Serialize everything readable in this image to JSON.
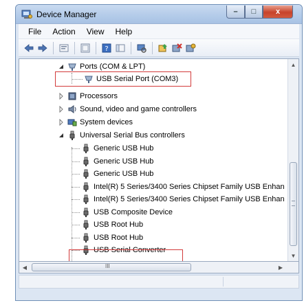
{
  "window": {
    "title": "Device Manager",
    "min_label": "–",
    "max_label": "□",
    "close_label": "x"
  },
  "menu": [
    "File",
    "Action",
    "View",
    "Help"
  ],
  "toolbar": {
    "icons": [
      "back-arrow-icon",
      "forward-arrow-icon",
      "properties-icon",
      "show-hidden-icon",
      "help-icon",
      "console-tree-icon",
      "scan-hardware-icon",
      "update-driver-icon",
      "uninstall-icon",
      "disable-icon"
    ]
  },
  "tree": {
    "ports": {
      "label": "Ports (COM & LPT)",
      "expanded": true
    },
    "usb_serial_port": {
      "label": "USB Serial Port (COM3)",
      "highlighted": true
    },
    "processors": {
      "label": "Processors"
    },
    "sound": {
      "label": "Sound, video and game controllers"
    },
    "system": {
      "label": "System devices"
    },
    "usb_controllers": {
      "label": "Universal Serial Bus controllers",
      "expanded": true
    },
    "usb_children": [
      "Generic USB Hub",
      "Generic USB Hub",
      "Generic USB Hub",
      "Intel(R) 5 Series/3400 Series Chipset Family USB Enhan",
      "Intel(R) 5 Series/3400 Series Chipset Family USB Enhan",
      "USB Composite Device",
      "USB Root Hub",
      "USB Root Hub",
      "USB Serial Converter"
    ],
    "highlight_color": "#d23a3a"
  },
  "scrollbars": {
    "vertical_up": "▲",
    "vertical_down": "▼",
    "horizontal_left": "◀",
    "horizontal_right": "▶",
    "horizontal_grip": "III"
  }
}
